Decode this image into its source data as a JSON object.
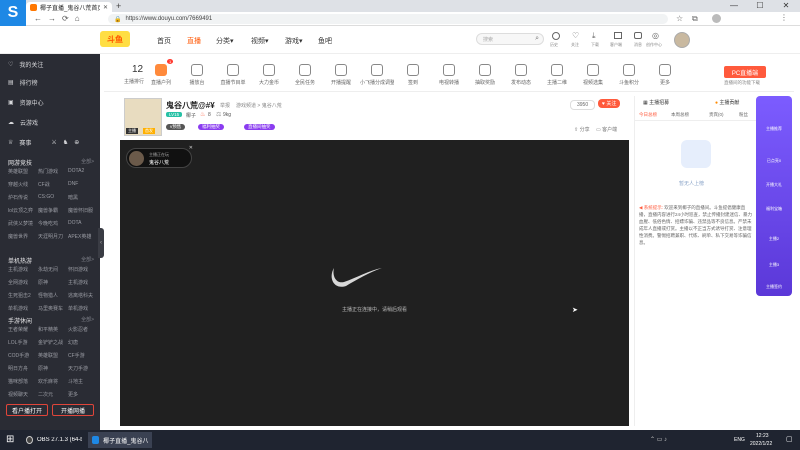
{
  "browser": {
    "tab_title": "椰子直播_鬼谷八荒首页",
    "url": "https://www.douyu.com/7669491",
    "controls": {
      "minimize": "—",
      "maximize": "☐",
      "close": "✕"
    }
  },
  "site": {
    "logo_text": "斗鱼",
    "nav": [
      "首页",
      "直播",
      "分类▾",
      "视频▾",
      "游戏▾",
      "鱼吧"
    ],
    "search_placeholder": "搜索",
    "header_icons": [
      "历史",
      "关注",
      "下载",
      "客户端",
      "消息",
      "创作中心"
    ]
  },
  "sidebar": {
    "top_items": [
      {
        "label": "我的关注",
        "icon": "heart-icon"
      },
      {
        "label": "排行榜",
        "icon": "rank-icon"
      },
      {
        "label": "资源中心",
        "icon": "resource-icon"
      },
      {
        "label": "云游戏",
        "icon": "cloud-icon"
      }
    ],
    "events_label": "赛事",
    "sections": [
      {
        "title": "网游竞技",
        "more": "全部>",
        "grid": [
          [
            "英雄联盟",
            "热门游戏",
            "DOTA2"
          ],
          [
            "穿越火线",
            "CF战",
            "DNF"
          ],
          [
            "炉石传说",
            "CS:GO",
            "暗黑"
          ],
          [
            "lol云顶之弈",
            "魔兽争霸",
            "魔兽怀旧服"
          ],
          [
            "武侠乂梦境",
            "今晚吃鸡",
            "DOTA"
          ],
          [
            "魔兽世界",
            "天涯明月刀",
            "APEX英雄"
          ]
        ]
      },
      {
        "title": "单机热游",
        "more": "全部>",
        "grid": [
          [
            "主机游戏",
            "永劫无间",
            "怀旧游戏"
          ],
          [
            "全网游戏",
            "原神",
            "主机游戏"
          ],
          [
            "生死狙击2",
            "怪物猎人",
            "逃离塔科夫"
          ],
          [
            "单机游戏",
            "马里奥赛车",
            "单机游戏"
          ]
        ]
      },
      {
        "title": "手游休闲",
        "more": "全部>",
        "grid": [
          [
            "王者荣耀",
            "和平精英",
            "火影忍者"
          ],
          [
            "LOL手游",
            "金铲铲之战",
            "幻唐"
          ],
          [
            "COD手游",
            "英雄联盟",
            "CF手游"
          ],
          [
            "明日方舟",
            "原神",
            "天刀手游"
          ],
          [
            "猫咪部落",
            "欢乐麻将",
            "斗地主"
          ],
          [
            "视频聊天",
            "二次元",
            "更多"
          ]
        ]
      }
    ],
    "buttons": [
      "看户播打开",
      "开播网播"
    ]
  },
  "categories": [
    {
      "label": "主播排行",
      "value": "12"
    },
    {
      "label": "直播户列",
      "badge": "1"
    },
    {
      "label": "播放台"
    },
    {
      "label": "直播节目单"
    },
    {
      "label": "大力金币"
    },
    {
      "label": "全民任务"
    },
    {
      "label": "开播提醒"
    },
    {
      "label": "小飞播分成调整"
    },
    {
      "label": "签到"
    },
    {
      "label": "电视转播"
    },
    {
      "label": "抽取奖励"
    },
    {
      "label": "发布动态"
    },
    {
      "label": "主播二维"
    },
    {
      "label": "视频选集"
    },
    {
      "label": "斗鱼积分"
    },
    {
      "label": "更多"
    }
  ],
  "pc_app": {
    "button": "PC直播端",
    "sub": "直播间的功能下载"
  },
  "room": {
    "title": "鬼谷八荒@#¥",
    "report": "举报",
    "breadcrumb": "游戏频道 > 鬼谷八荒",
    "level_badge": "LV15",
    "streamer": "椰子",
    "hot": "8",
    "weight": "9kg",
    "tags": [
      "v预售",
      "福利抽奖",
      "直播间抽奖"
    ],
    "follow_count": "3950",
    "follow_button": "关注",
    "share": "分享",
    "client": "客户端",
    "avatar_labels": [
      "主播",
      "首发"
    ]
  },
  "video": {
    "mini_title": "主播正在玩",
    "mini_game": "鬼谷八荒",
    "status": "主播正在连接中，请稍后观看"
  },
  "chat": {
    "tab1": "主播招募",
    "tab2": "主播贡献",
    "subtabs": [
      "今日总榜",
      "本周总榜",
      "贵宾(0)",
      "粉丝"
    ],
    "empty_text": "暂无人上榜",
    "system_label": "系统提示:",
    "system_text": "欢迎来到椰子的直播间。斗鱼提倡健康直播，直播内容进行24小时巡查，禁止传播封建迷信、暴力血腥、低俗色情、招嫖诈骗、违禁品等不良信息。严禁未成年人直播或打赏。主播以不正当方式诱导打赏、注意理性消费。警惕招聘兼职、代练、刷单、私下交易等诈骗信息。"
  },
  "promo": {
    "items": [
      "主播推荐",
      "已点亮0",
      "开播大礼",
      "福利宝箱",
      "主播2",
      "主播3",
      "主播签约"
    ]
  },
  "taskbar": {
    "items": [
      "OBS 27.1.3 (64-bit...",
      "椰子直播_鬼谷八..."
    ],
    "lang": "ENG",
    "time": "12:23",
    "date": "2022/1/22"
  }
}
